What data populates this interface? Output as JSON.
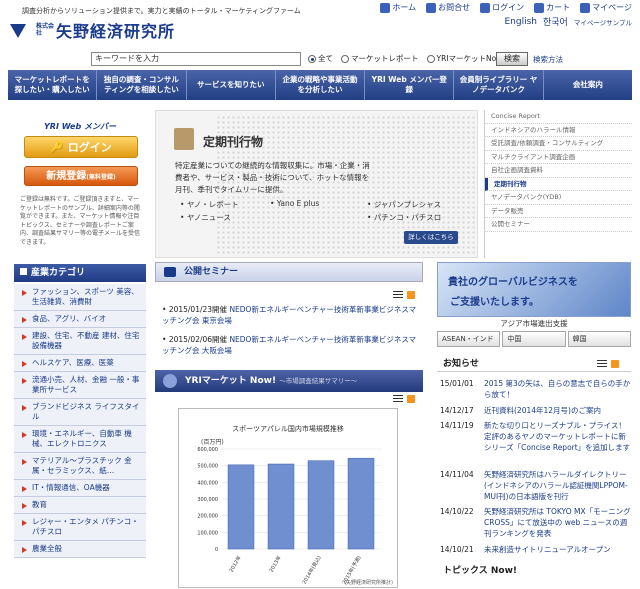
{
  "header": {
    "tagline": "調査分析からソリューション提供まで。実力と実績のトータル・マーケティングファーム",
    "logo_small": "株式会社",
    "logo_text": "矢野経済研究所",
    "util": [
      {
        "icon": "home-icon",
        "label": "ホーム"
      },
      {
        "icon": "mail-icon",
        "label": "お問合せ"
      },
      {
        "icon": "login-icon",
        "label": "ログイン"
      },
      {
        "icon": "cart-icon",
        "label": "カート"
      },
      {
        "icon": "mypage-icon",
        "label": "マイページ"
      }
    ],
    "util2": [
      "English",
      "한국어",
      "マイページサンプル"
    ]
  },
  "search": {
    "value": "キーワードを入力",
    "options": [
      "全て",
      "マーケットレポート",
      "YRIマーケットNow！"
    ],
    "button": "検索",
    "help": "検索方法"
  },
  "nav": [
    "マーケットレポートを探したい・購入したい",
    "独自の調査・コンサルティングを相談したい",
    "サービスを知りたい",
    "企業の戦略や事業活動を分析したい",
    "YRI Web メンバー登録",
    "会員制ライブラリー ヤノデータバンク",
    "会社案内"
  ],
  "member": {
    "title": "YRI Web メンバー",
    "login": "ログイン",
    "register": "新規登録",
    "register_note": "(無料登録)",
    "note": "ご登録は無料です。ご登録頂きますと、マーケットレポートのサンプル、詳細案内等の閲覧ができます。また、マーケット情報や注目トピックス、セミナーや調査レポートご案内、調査結果サマリー等の電子メールを受信できます。"
  },
  "categories": {
    "title": "産業カテゴリ",
    "items": [
      "ファッション、スポーツ 美容、生活雑貨、消費財",
      "食品、アグリ、バイオ",
      "建設、住宅、不動産 建材、住宅設備機器",
      "ヘルスケア、医療、医薬",
      "流通小売、人材、金融 一般・事業所サービス",
      "ブランドビジネス ライフスタイル",
      "環境・エネルギー、自動車 機械、エレクトロニクス",
      "マテリアル〜プラスチック 金属・セラミックス、紙…",
      "IT・情報通信、OA機器",
      "教育",
      "レジャー・エンタメ パチンコ・パチスロ",
      "農業全般"
    ]
  },
  "feature": {
    "title": "定期刊行物",
    "desc": "特定産業についての継続的な情報収集に。市場・企業・消費者や、サービス・製品・技術について、ホットな情報を月刊、季刊でタイムリーに提供。",
    "bullets": [
      "ヤノ・レポート",
      "Yano E plus",
      "ジャパンプレシャス",
      "ヤノニュース",
      "パチンコ・パチスロ"
    ],
    "more": "詳しくはこちら"
  },
  "right_menu": [
    "Concise Report",
    "インドネシアのハラール情報",
    "受託調査/依頼調査・コンサルティング",
    "マルチクライアント調査企画",
    "自社企画調査資料",
    "定期刊行物",
    "ヤノデータバンク(YDB)",
    "データ販売",
    "公開セミナー"
  ],
  "seminar": {
    "title": "公開セミナー",
    "items": [
      {
        "date": "2015/01/23開催",
        "text": "NEDO新エネルギーベンチャー技術革新事業ビジネスマッチング会 東京会場"
      },
      {
        "date": "2015/02/06開催",
        "text": "NEDO新エネルギーベンチャー技術革新事業ビジネスマッチング会 大阪会場"
      }
    ]
  },
  "market": {
    "title": "YRIマーケット Now!",
    "subtitle": "〜市場調査結果サマリー〜"
  },
  "chart_data": {
    "type": "bar",
    "title": "スポーツアパレル国内市場規模推移",
    "ylabel": "(百万円)",
    "categories": [
      "2012年",
      "2013年",
      "2014年(見込)",
      "2015年(予測)"
    ],
    "values": [
      505000,
      510000,
      530000,
      545000
    ],
    "ylim": [
      0,
      600000
    ],
    "yticks": [
      "600,000",
      "500,000",
      "400,000",
      "300,000",
      "200,000",
      "100,000",
      "0"
    ],
    "note": "(矢野経済研究所推計)"
  },
  "banner": {
    "line1": "貴社のグローバルビジネスを",
    "line2": "ご支援いたします。"
  },
  "asia": {
    "title": "アジア市場進出支援",
    "tabs": [
      "ASEAN・インド",
      "中国",
      "韓国"
    ]
  },
  "news": {
    "title": "お知らせ",
    "items": [
      {
        "date": "15/01/01",
        "text": "2015 第3の矢は、自らの意志で自らの手から放て！"
      },
      {
        "date": "14/12/17",
        "text": "近刊資料(2014年12月号)のご案内"
      },
      {
        "date": "14/11/19",
        "text": "新たな切り口とリーズナブル・プライス！定評のあるヤノのマーケットレポートに新シリーズ「Concise Report」を追加します"
      },
      {
        "date": "14/11/04",
        "text": "矢野経済研究所はハラールダイレクトリー(インドネシアのハラール認証機関LPPOM-MUI刊)の日本語版を刊行"
      },
      {
        "date": "14/10/22",
        "text": "矢野経済研究所は TOKYO MX「モーニングCROSS」にて放送中の web ニュースの週刊ランキングを発表"
      },
      {
        "date": "14/10/21",
        "text": "未来創造サイトリニューアルオープン"
      }
    ]
  },
  "topics": {
    "title": "トピックス Now!"
  }
}
